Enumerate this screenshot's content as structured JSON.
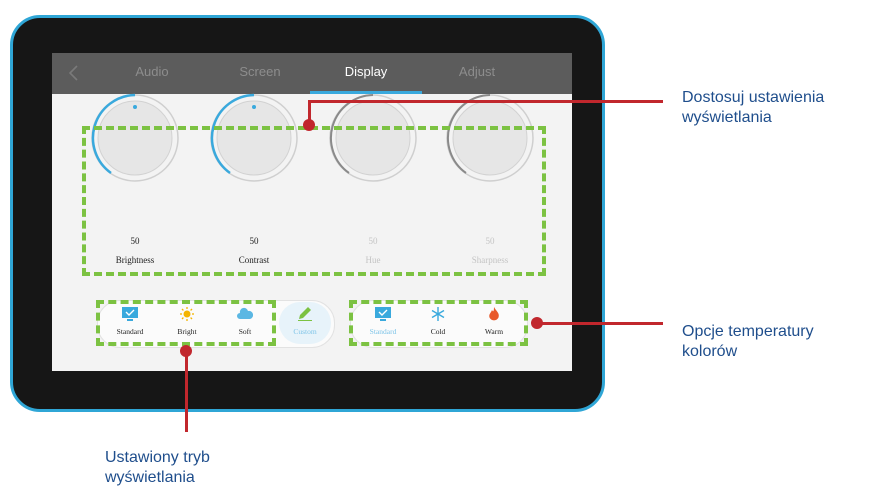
{
  "tabs": [
    {
      "label": "Audio",
      "active": false
    },
    {
      "label": "Screen",
      "active": false
    },
    {
      "label": "Display",
      "active": true
    },
    {
      "label": "Adjust",
      "active": false
    }
  ],
  "knobs": [
    {
      "label": "Brightness",
      "value": "50",
      "enabled": true
    },
    {
      "label": "Contrast",
      "value": "50",
      "enabled": true
    },
    {
      "label": "Hue",
      "value": "50",
      "enabled": false
    },
    {
      "label": "Sharpness",
      "value": "50",
      "enabled": false
    }
  ],
  "display_modes": [
    {
      "label": "Standard",
      "icon": "monitor-icon",
      "selected": false
    },
    {
      "label": "Bright",
      "icon": "sun-icon",
      "selected": false
    },
    {
      "label": "Soft",
      "icon": "cloud-icon",
      "selected": false
    },
    {
      "label": "Custom",
      "icon": "pencil-icon",
      "selected": true
    }
  ],
  "color_temperatures": [
    {
      "label": "Standard",
      "icon": "monitor-icon",
      "selected": true
    },
    {
      "label": "Cold",
      "icon": "snowflake-icon",
      "selected": false
    },
    {
      "label": "Warm",
      "icon": "flame-icon",
      "selected": false
    }
  ],
  "callouts": {
    "display_settings": "Dostosuj ustawienia wyświetlania",
    "color_temperature": "Opcje temperatury kolorów",
    "display_mode": "Ustawiony tryb wyświetlania"
  },
  "colors": {
    "accent": "#39a9dd",
    "highlight": "#7cc242",
    "callout": "#c1272d",
    "callout_text": "#1f4e8c"
  }
}
